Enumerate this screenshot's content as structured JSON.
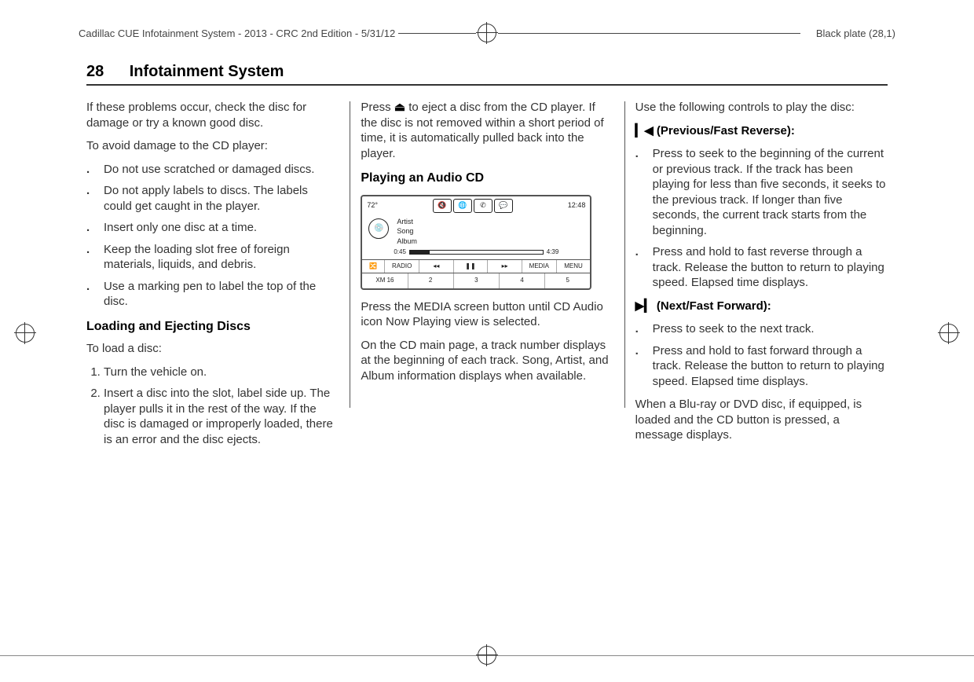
{
  "meta": {
    "doc_title": "Cadillac CUE Infotainment System - 2013 - CRC 2nd Edition - 5/31/12",
    "plate": "Black plate (28,1)"
  },
  "header": {
    "page_num": "28",
    "title": "Infotainment System"
  },
  "col1": {
    "p1": "If these problems occur, check the disc for damage or try a known good disc.",
    "p2": "To avoid damage to the CD player:",
    "bullets": [
      "Do not use scratched or damaged discs.",
      "Do not apply labels to discs. The labels could get caught in the player.",
      "Insert only one disc at a time.",
      "Keep the loading slot free of foreign materials, liquids, and debris.",
      "Use a marking pen to label the top of the disc."
    ],
    "sub1": "Loading and Ejecting Discs",
    "p3": "To load a disc:",
    "steps": [
      "Turn the vehicle on.",
      "Insert a disc into the slot, label side up. The player pulls it in the rest of the way. If the disc is damaged or improperly loaded, there is an error and the disc ejects."
    ]
  },
  "col2": {
    "p1a": "Press ",
    "p1b": " to eject a disc from the CD player. If the disc is not removed within a short period of time, it is automatically pulled back into the player.",
    "sub1": "Playing an Audio CD",
    "fig": {
      "temp": "72°",
      "time": "12:48",
      "artist": "Artist",
      "song": "Song",
      "album": "Album",
      "elapsed": "0:45",
      "total": "4:39",
      "btns": [
        "RADIO",
        "◂◂",
        "❚❚",
        "▸▸",
        "MEDIA",
        "MENU"
      ],
      "fav": [
        "XM 16",
        "2",
        "3",
        "4",
        "5"
      ]
    },
    "p2": "Press the MEDIA screen button until CD Audio icon Now Playing view is selected.",
    "p3": "On the CD main page, a track number displays at the beginning of each track. Song, Artist, and Album information displays when available."
  },
  "col3": {
    "p1": "Use the following controls to play the disc:",
    "prev_label": "(Previous/Fast Reverse):",
    "prev_bullets": [
      "Press to seek to the beginning of the current or previous track. If the track has been playing for less than five seconds, it seeks to the previous track. If longer than five seconds, the current track starts from the beginning.",
      "Press and hold to fast reverse through a track. Release the button to return to playing speed. Elapsed time displays."
    ],
    "next_label": "(Next/Fast Forward):",
    "next_bullets": [
      "Press to seek to the next track.",
      "Press and hold to fast forward through a track. Release the button to return to playing speed. Elapsed time displays."
    ],
    "p2": "When a Blu-ray or DVD disc, if equipped, is loaded and the CD button is pressed, a message displays."
  }
}
